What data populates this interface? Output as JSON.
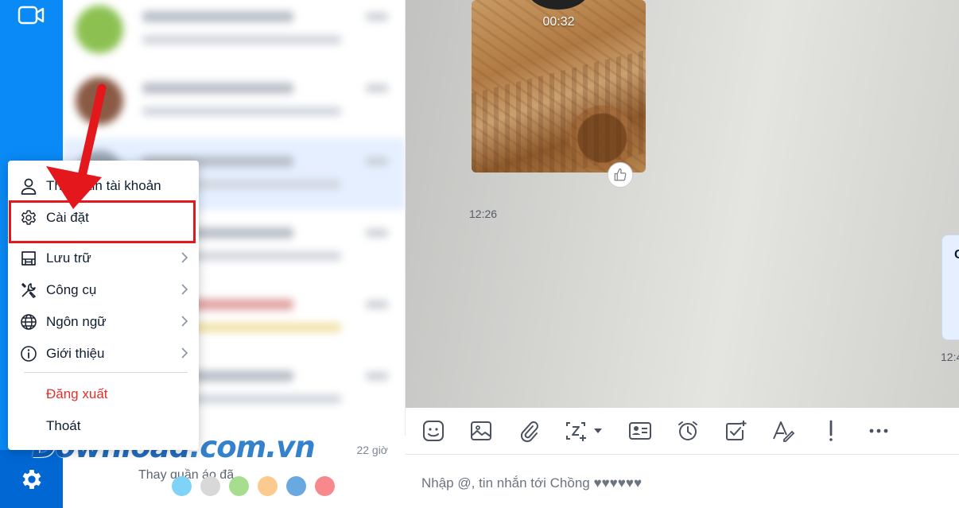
{
  "nav": {
    "video_icon": "video-camera-icon",
    "settings_icon": "gear-icon",
    "accent": "#0a8af6"
  },
  "conversation_list": {
    "bottom_preview": "Thay quần áo đã",
    "bottom_time": "22 giờ",
    "reaction_colors": [
      "#7fd3f7",
      "#d8d8d8",
      "#a6dd8f",
      "#fcc98e",
      "#6aa9e0",
      "#f7888c"
    ]
  },
  "watermark": {
    "part1": "Download",
    "part2": ".com.vn"
  },
  "menu": {
    "items": [
      {
        "label": "Thông tin tài khoản",
        "icon": "user-icon",
        "chevron": false
      },
      {
        "label": "Cài đặt",
        "icon": "gear-icon",
        "chevron": false
      },
      {
        "label": "Lưu trữ",
        "icon": "storage-icon",
        "chevron": true
      },
      {
        "label": "Công cụ",
        "icon": "tools-icon",
        "chevron": true
      },
      {
        "label": "Ngôn ngữ",
        "icon": "globe-icon",
        "chevron": true
      },
      {
        "label": "Giới thiệu",
        "icon": "info-icon",
        "chevron": true
      }
    ],
    "logout": "Đăng xuất",
    "quit": "Thoát",
    "highlight_color": "#e3171c"
  },
  "chat": {
    "video_duration": "00:32",
    "video_time": "12:26",
    "right_bubble_char": "C",
    "right_time": "12:4"
  },
  "toolbar": {
    "icons": [
      "sticker-icon",
      "image-icon",
      "attachment-icon",
      "screenshot-icon",
      "contact-card-icon",
      "reminder-clock-icon",
      "task-check-icon",
      "text-format-icon",
      "urgent-exclamation-icon",
      "more-icon"
    ]
  },
  "composer": {
    "placeholder": "Nhập @, tin nhắn tới Chồng ♥♥♥♥♥♥"
  }
}
